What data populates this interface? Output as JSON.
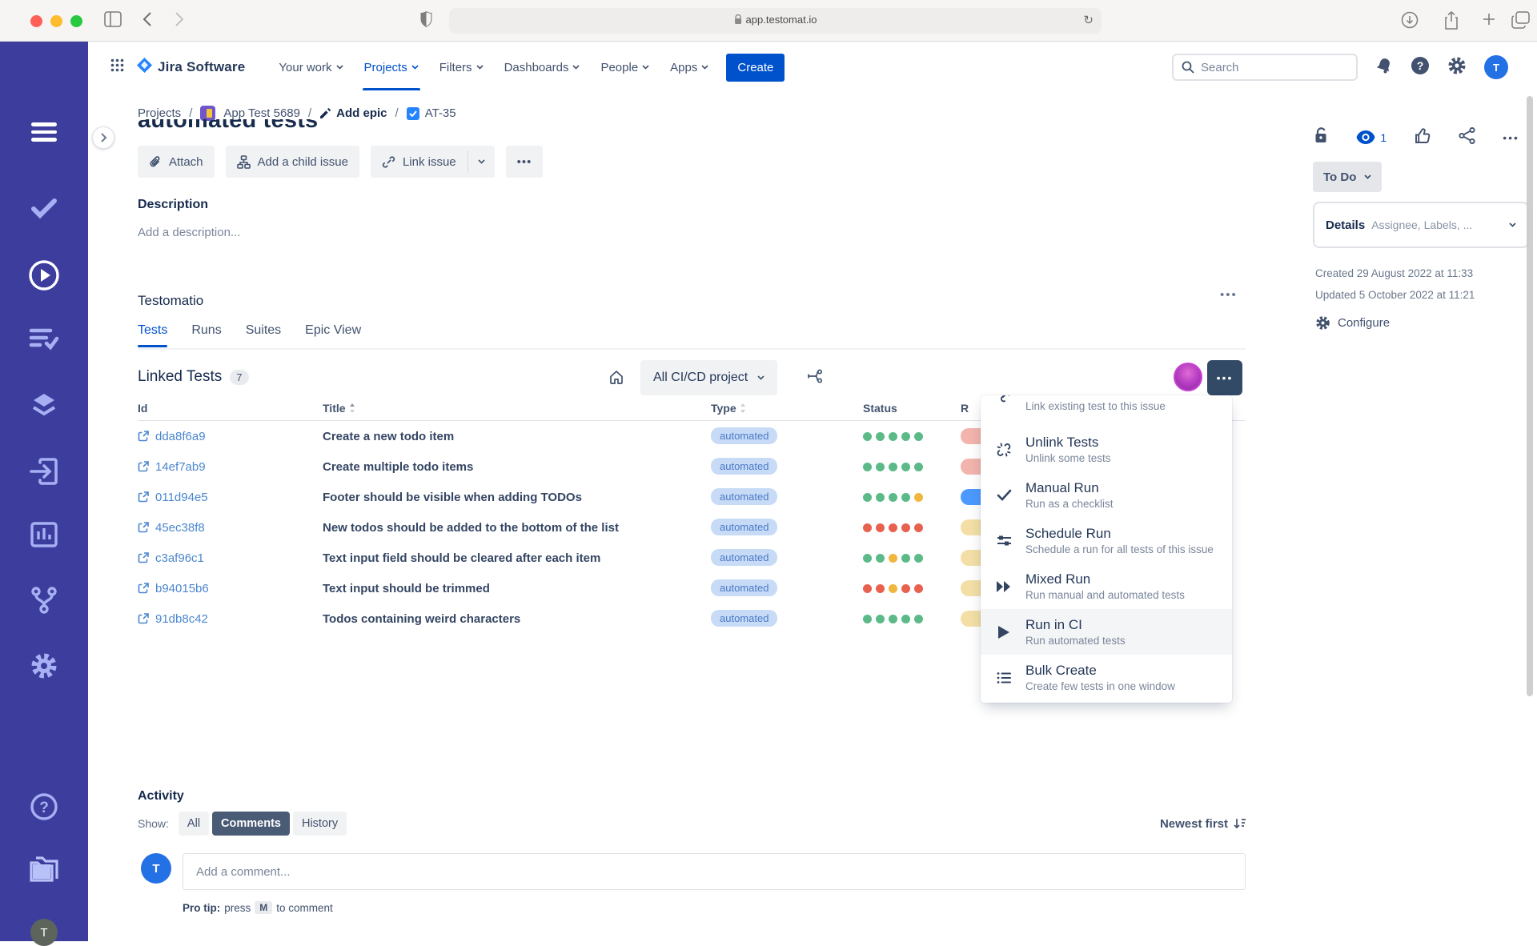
{
  "browser": {
    "url": "app.testomat.io",
    "traffic_colors": {
      "close": "#ff5f57",
      "minimize": "#febc2e",
      "zoom": "#28c840"
    }
  },
  "header": {
    "brand": "Jira Software",
    "nav": [
      {
        "label": "Your work",
        "active": false
      },
      {
        "label": "Projects",
        "active": true
      },
      {
        "label": "Filters",
        "active": false
      },
      {
        "label": "Dashboards",
        "active": false
      },
      {
        "label": "People",
        "active": false
      },
      {
        "label": "Apps",
        "active": false
      }
    ],
    "create_label": "Create",
    "search_placeholder": "Search",
    "avatar_initial": "T",
    "accent_color": "#0052cc"
  },
  "breadcrumb": {
    "project_link": "Projects",
    "app_name": "App Test 5689",
    "epic_link": "Add epic",
    "issue_key": "AT-35"
  },
  "issue": {
    "title": "automated tests",
    "toolbar": {
      "attach": "Attach",
      "add_child": "Add a child issue",
      "link_issue": "Link issue",
      "more": "•••"
    },
    "description_label": "Description",
    "description_placeholder": "Add a description..."
  },
  "testomatio": {
    "section_title": "Testomatio",
    "more": "•••",
    "tabs": [
      {
        "label": "Tests",
        "active": true
      },
      {
        "label": "Runs",
        "active": false
      },
      {
        "label": "Suites",
        "active": false
      },
      {
        "label": "Epic View",
        "active": false
      }
    ],
    "linked_tests_label": "Linked Tests",
    "linked_count": "7",
    "project_filter": "All CI/CD project",
    "columns": {
      "id": "Id",
      "title": "Title",
      "type": "Type",
      "status": "Status",
      "partial": "R"
    },
    "rows": [
      {
        "id": "dda8f6a9",
        "title": "Create a new todo item",
        "type": "automated",
        "dots": [
          "green",
          "green",
          "green",
          "green",
          "green"
        ],
        "edge": "pink"
      },
      {
        "id": "14ef7ab9",
        "title": "Create multiple todo items",
        "type": "automated",
        "dots": [
          "green",
          "green",
          "green",
          "green",
          "green"
        ],
        "edge": "pink"
      },
      {
        "id": "011d94e5",
        "title": "Footer should be visible when adding TODOs",
        "type": "automated",
        "dots": [
          "green",
          "green",
          "green",
          "green",
          "yellow"
        ],
        "edge": "blue"
      },
      {
        "id": "45ec38f8",
        "title": "New todos should be added to the bottom of the list",
        "type": "automated",
        "dots": [
          "red",
          "red",
          "red",
          "red",
          "red"
        ],
        "edge": "yellow"
      },
      {
        "id": "c3af96c1",
        "title": "Text input field should be cleared after each item",
        "type": "automated",
        "dots": [
          "green",
          "green",
          "yellow",
          "green",
          "green"
        ],
        "edge": "yellow"
      },
      {
        "id": "b94015b6",
        "title": "Text input should be trimmed",
        "type": "automated",
        "dots": [
          "red",
          "red",
          "yellow",
          "red",
          "red"
        ],
        "edge": "yellow"
      },
      {
        "id": "91db8c42",
        "title": "Todos containing weird characters",
        "type": "automated",
        "dots": [
          "green",
          "green",
          "green",
          "green",
          "green"
        ],
        "edge": "yellow"
      }
    ],
    "dot_colors": {
      "green": "#5cba89",
      "yellow": "#f0b63f",
      "red": "#e8614f"
    },
    "edge_colors": {
      "pink": "#f2b4ac",
      "blue": "#4c9aff",
      "yellow": "#f3dfa6"
    }
  },
  "menu": {
    "items": [
      {
        "title": "",
        "subtitle": "Link existing test to this issue",
        "icon": "link-icon",
        "clipped": true,
        "highlighted": false
      },
      {
        "title": "Unlink Tests",
        "subtitle": "Unlink some tests",
        "icon": "unlink-icon",
        "clipped": false,
        "highlighted": false
      },
      {
        "title": "Manual Run",
        "subtitle": "Run as a checklist",
        "icon": "check-icon",
        "clipped": false,
        "highlighted": false
      },
      {
        "title": "Schedule Run",
        "subtitle": "Schedule a run for all tests of this issue",
        "icon": "sliders-icon",
        "clipped": false,
        "highlighted": false
      },
      {
        "title": "Mixed Run",
        "subtitle": "Run manual and automated tests",
        "icon": "fast-forward-icon",
        "clipped": false,
        "highlighted": false
      },
      {
        "title": "Run in CI",
        "subtitle": "Run automated tests",
        "icon": "play-icon",
        "clipped": false,
        "highlighted": true
      },
      {
        "title": "Bulk Create",
        "subtitle": "Create few tests in one window",
        "icon": "bulk-list-icon",
        "clipped": false,
        "highlighted": false
      }
    ]
  },
  "details_panel": {
    "watchers_count": "1",
    "more": "•••",
    "status_label": "To Do",
    "details_label": "Details",
    "details_hint": "Assignee, Labels, ...",
    "created": "Created 29 August 2022 at 11:33",
    "updated": "Updated 5 October 2022 at 11:21",
    "configure_label": "Configure"
  },
  "activity": {
    "title": "Activity",
    "show_label": "Show:",
    "filters": [
      {
        "label": "All",
        "selected": false
      },
      {
        "label": "Comments",
        "selected": true
      },
      {
        "label": "History",
        "selected": false
      }
    ],
    "sort_label": "Newest first",
    "comment_placeholder": "Add a comment...",
    "protip_prefix": "Pro tip:",
    "protip_press": "press",
    "protip_key": "M",
    "protip_suffix": "to comment",
    "avatar_initial": "T"
  }
}
